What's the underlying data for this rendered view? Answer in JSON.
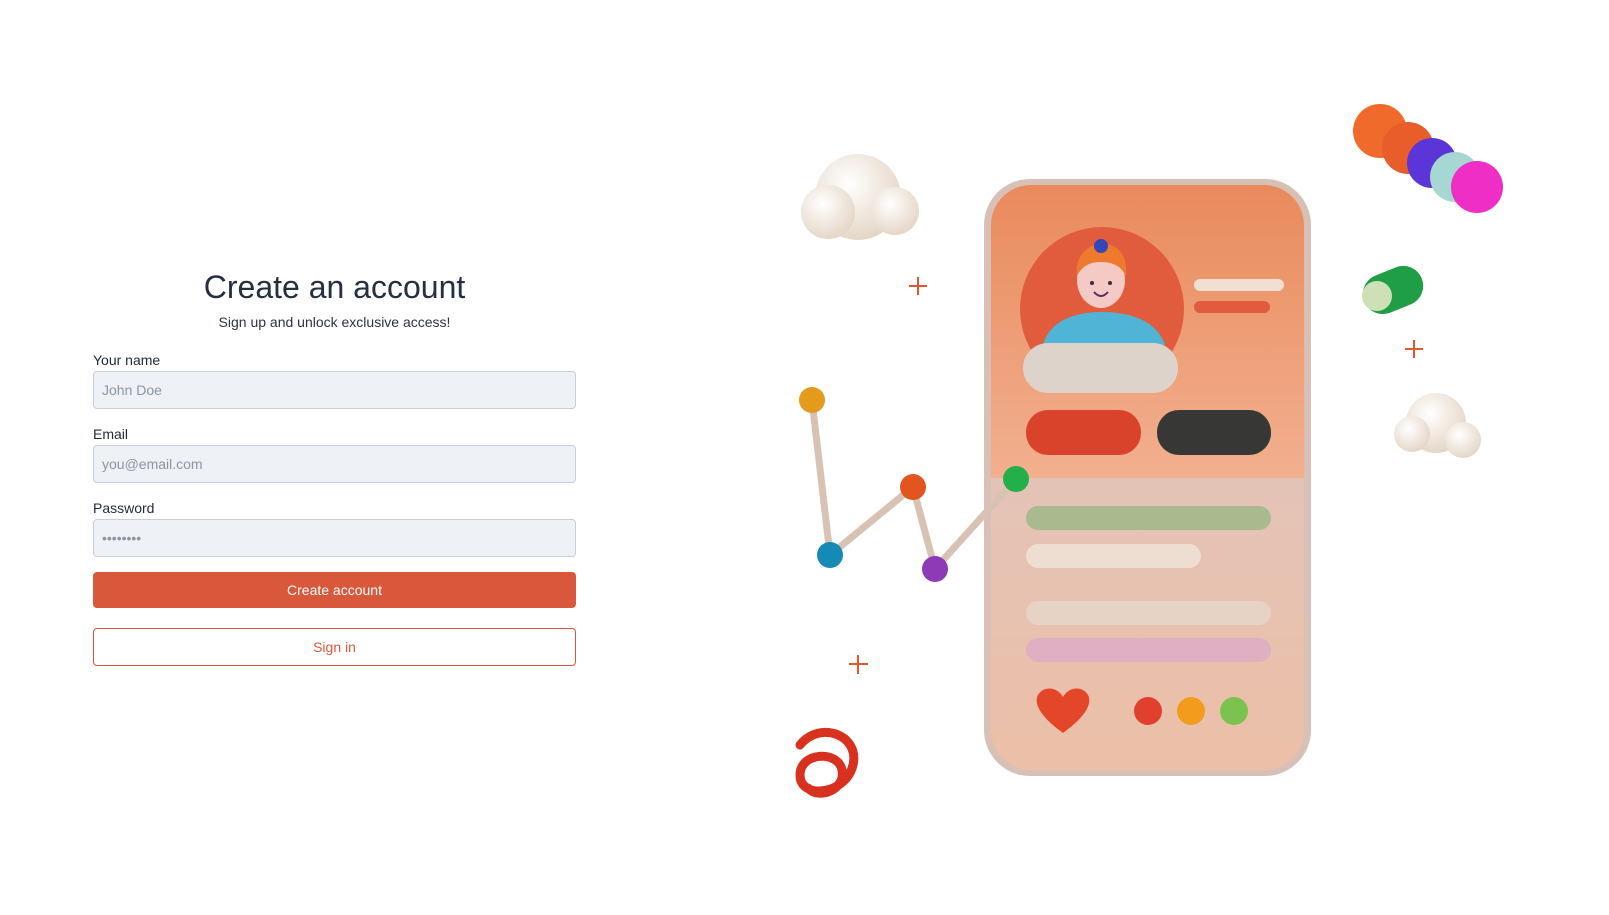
{
  "form": {
    "title": "Create an account",
    "subtitle": "Sign up and unlock exclusive access!",
    "name_label": "Your name",
    "name_placeholder": "John Doe",
    "email_label": "Email",
    "email_placeholder": "you@email.com",
    "password_label": "Password",
    "password_placeholder": "••••••••",
    "create_button_label": "Create account",
    "signin_button_label": "Sign in"
  },
  "colors": {
    "accent": "#d9583c",
    "input_background": "#eef2f7",
    "title_text": "#243042"
  },
  "illustration": {
    "icons": [
      "cloud-icon",
      "phone-mockup-icon",
      "avatar-icon",
      "heart-icon",
      "toggle-switch-icon",
      "sparkle-plus-icon",
      "spiral-icon",
      "line-graph-icon",
      "striped-blob-icon"
    ]
  }
}
